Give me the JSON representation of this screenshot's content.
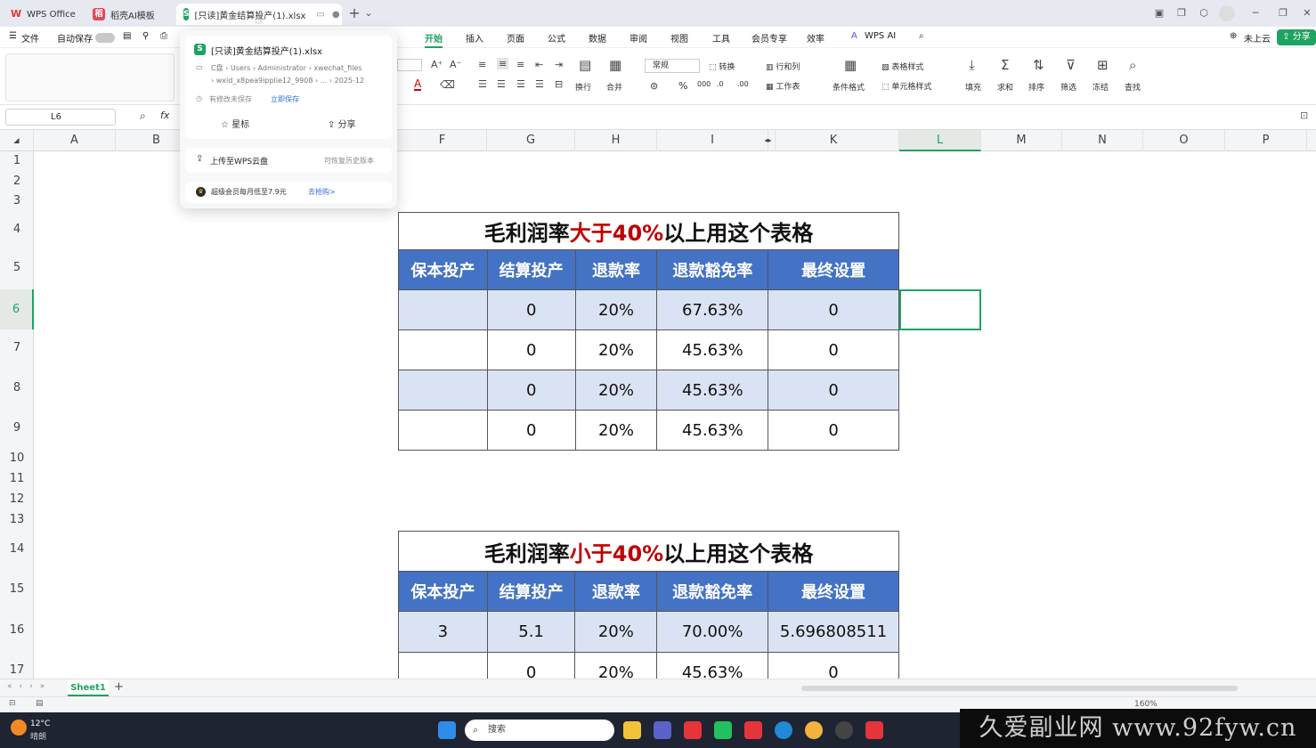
{
  "tabs": [
    {
      "label": "WPS Office",
      "icon": "wps-logo-icon",
      "color": "#e5343a"
    },
    {
      "label": "稻壳AI模板",
      "icon": "docer-icon",
      "color": "#e8465a"
    },
    {
      "label": "[只读]黄金结算投产(1).xlsx",
      "icon": "spreadsheet-icon",
      "color": "#1ea362"
    }
  ],
  "menubar": {
    "file": "文件",
    "autosave": "自动保存",
    "items": [
      "开始",
      "插入",
      "页面",
      "公式",
      "数据",
      "审阅",
      "视图",
      "工具",
      "会员专享",
      "效率"
    ],
    "active": "开始",
    "wps_ai": "WPS AI",
    "cloud": "未上云",
    "share": "分享"
  },
  "ribbon": {
    "number_format": "常规",
    "convert": "转换",
    "rows_cols": "行和列",
    "table_style": "表格样式",
    "wrap": "换行",
    "merge": "合并",
    "worksheet": "工作表",
    "cond_format": "条件格式",
    "cell_style": "单元格样式",
    "fill": "填充",
    "sum": "求和",
    "sort": "排序",
    "filter": "筛选",
    "freeze": "冻结",
    "find": "查找"
  },
  "formula": {
    "cell_ref": "L6",
    "fx": "fx"
  },
  "columns": [
    "A",
    "B",
    "",
    "",
    "",
    "F",
    "G",
    "H",
    "I",
    "",
    "K",
    "L",
    "M",
    "N",
    "O",
    "P"
  ],
  "rows": [
    "1",
    "2",
    "3",
    "4",
    "5",
    "6",
    "7",
    "8",
    "9",
    "10",
    "11",
    "12",
    "13",
    "14",
    "15",
    "16",
    "17"
  ],
  "table1": {
    "title_pre": "毛利润率",
    "title_mid": "大于40%",
    "title_post": "以上用这个表格",
    "headers": [
      "保本投产",
      "结算投产",
      "退款率",
      "退款豁免率",
      "最终设置"
    ],
    "rows": [
      [
        "",
        "0",
        "20%",
        "67.63%",
        "0"
      ],
      [
        "",
        "0",
        "20%",
        "45.63%",
        "0"
      ],
      [
        "",
        "0",
        "20%",
        "45.63%",
        "0"
      ],
      [
        "",
        "0",
        "20%",
        "45.63%",
        "0"
      ]
    ]
  },
  "table2": {
    "title_pre": "毛利润率",
    "title_mid": "小于40%",
    "title_post": "以上用这个表格",
    "headers": [
      "保本投产",
      "结算投产",
      "退款率",
      "退款豁免率",
      "最终设置"
    ],
    "rows": [
      [
        "3",
        "5.1",
        "20%",
        "70.00%",
        "5.696808511"
      ],
      [
        "",
        "0",
        "20%",
        "45.63%",
        "0"
      ]
    ]
  },
  "popup": {
    "filename": "[只读]黄金结算投产(1).xlsx",
    "path1": "C盘 › Users › Administrator › xwechat_files",
    "path2": "› wxid_x8pea9ipplie12_9908 › ... › 2025-12",
    "unsaved": "有修改未保存",
    "save_now": "立即保存",
    "star": "星标",
    "share": "分享",
    "upload": "上传至WPS云盘",
    "history": "可恢复历史版本",
    "promo": "超级会员每月低至7.9元",
    "promo_link": "去抢购>"
  },
  "sheet": {
    "name": "Sheet1",
    "add": "+"
  },
  "status": {
    "zoom": "160%"
  },
  "taskbar": {
    "temp": "12°C",
    "weather": "晴朗",
    "search": "搜索"
  },
  "watermark": "久爱副业网 www.92fyw.cn"
}
